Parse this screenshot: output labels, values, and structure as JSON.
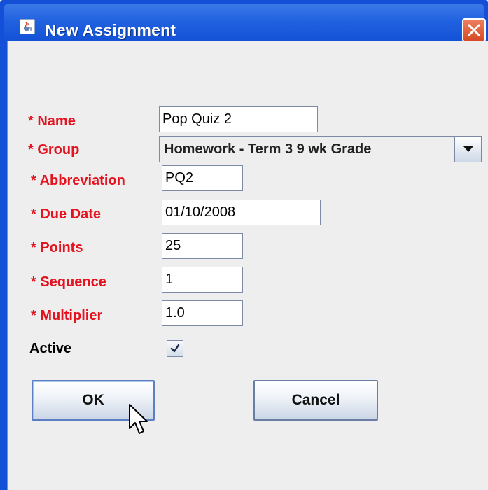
{
  "window": {
    "title": "New Assignment",
    "icons": {
      "app": "java-cup-icon",
      "close": "close-icon"
    }
  },
  "form": {
    "name": {
      "label": "* Name",
      "value": "Pop Quiz 2"
    },
    "group": {
      "label": "* Group",
      "selected": "Homework - Term 3 9 wk Grade"
    },
    "abbreviation": {
      "label": "* Abbreviation",
      "value": "PQ2"
    },
    "due_date": {
      "label": "* Due Date",
      "value": "01/10/2008"
    },
    "points": {
      "label": "* Points",
      "value": "25"
    },
    "sequence": {
      "label": "* Sequence",
      "value": "1"
    },
    "multiplier": {
      "label": "* Multiplier",
      "value": "1.0"
    },
    "active": {
      "label": "Active",
      "checked": true
    }
  },
  "buttons": {
    "ok": "OK",
    "cancel": "Cancel"
  },
  "colors": {
    "title_bar": "#2162e0",
    "required_label": "#e4131f",
    "client_background": "#eeeeee",
    "close_button": "#d64a24"
  }
}
